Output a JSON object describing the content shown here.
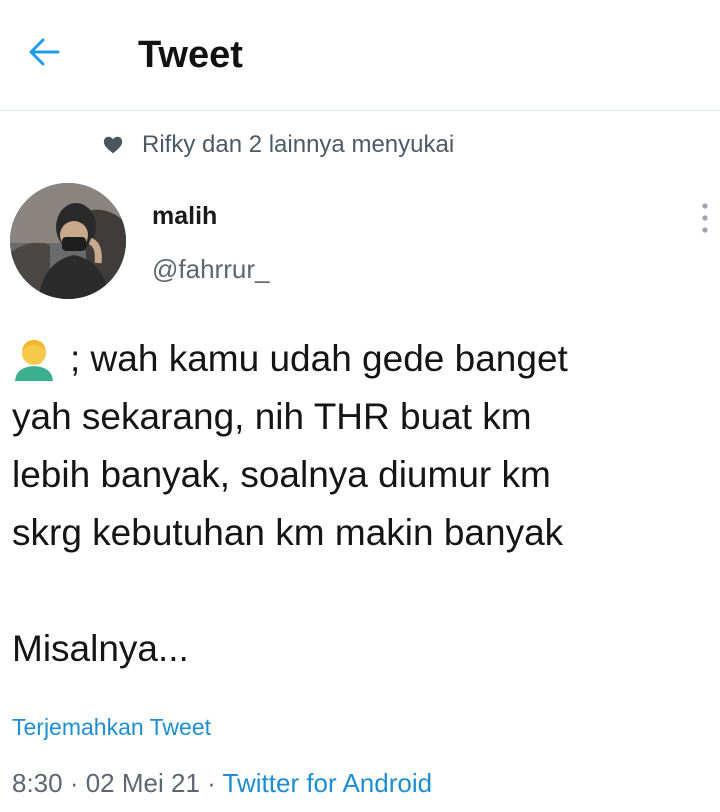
{
  "header": {
    "title": "Tweet",
    "back_icon": "arrow-left-icon",
    "accent_color": "#1d9bf0"
  },
  "social_context": {
    "icon": "heart-icon",
    "text": "Rifky dan 2 lainnya menyukai"
  },
  "author": {
    "name": "malih",
    "handle": "@fahrrur_",
    "avatar_icon": "avatar-photo",
    "more_icon": "more-vertical-icon"
  },
  "tweet": {
    "emoji_icon": "person-emoji-icon",
    "lines": [
      "; wah kamu udah gede banget",
      "yah sekarang, nih THR buat km",
      "lebih banyak, soalnya diumur km",
      "skrg kebutuhan km makin banyak"
    ],
    "paragraph2": "Misalnya..."
  },
  "translate_label": "Terjemahkan Tweet",
  "meta": {
    "time": "8:30",
    "separator": " · ",
    "date": "02 Mei 21",
    "source": "Twitter for Android"
  },
  "colors": {
    "link": "#1d8ecf",
    "secondary_text": "#5b6872",
    "divider": "#e1e8ed"
  }
}
